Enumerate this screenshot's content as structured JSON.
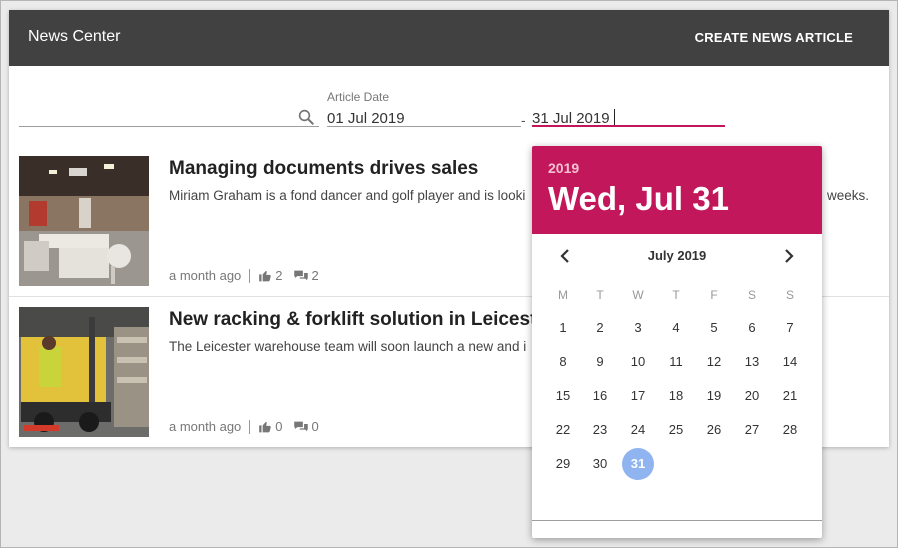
{
  "header": {
    "title": "News Center",
    "create_label": "CREATE NEWS ARTICLE"
  },
  "filters": {
    "search_value": "",
    "date_label": "Article Date",
    "date_from": "01 Jul 2019",
    "date_separator": "-",
    "date_to": "31 Jul 2019"
  },
  "articles": [
    {
      "title": "Managing documents drives sales",
      "description": "Miriam Graham is a fond dancer and golf player and is looki",
      "description_tail": "weeks.",
      "age": "a month ago",
      "likes": "2",
      "comments": "2"
    },
    {
      "title": "New racking & forklift solution in Leicest",
      "description": "The Leicester warehouse team will soon launch a new and i",
      "age": "a month ago",
      "likes": "0",
      "comments": "0"
    }
  ],
  "picker": {
    "year": "2019",
    "selected_label": "Wed, Jul 31",
    "month_label": "July 2019",
    "weekdays": [
      "M",
      "T",
      "W",
      "T",
      "F",
      "S",
      "S"
    ],
    "weeks": [
      [
        "1",
        "2",
        "3",
        "4",
        "5",
        "6",
        "7"
      ],
      [
        "8",
        "9",
        "10",
        "11",
        "12",
        "13",
        "14"
      ],
      [
        "15",
        "16",
        "17",
        "18",
        "19",
        "20",
        "21"
      ],
      [
        "22",
        "23",
        "24",
        "25",
        "26",
        "27",
        "28"
      ],
      [
        "29",
        "30",
        "31",
        "",
        "",
        "",
        ""
      ]
    ],
    "selected_day": "31"
  },
  "colors": {
    "accent": "#c2185b",
    "header_bg": "#414141",
    "selected_day": "#90b4f0"
  }
}
